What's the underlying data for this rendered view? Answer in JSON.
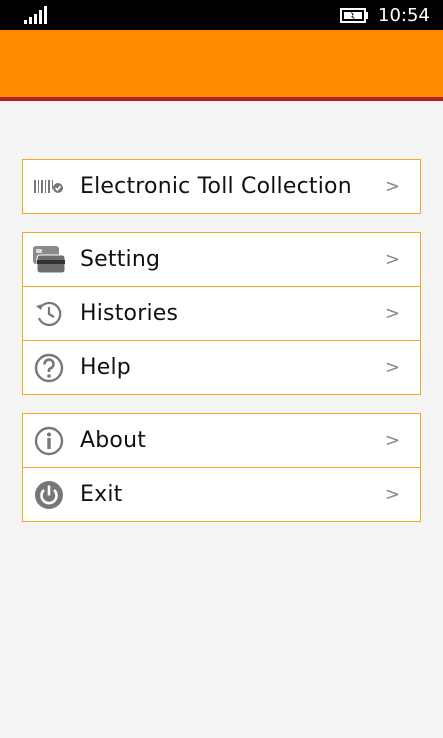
{
  "status_bar": {
    "time": "10:54"
  },
  "groups": [
    {
      "items": [
        {
          "label": "Electronic Toll Collection",
          "icon": "barcode-icon",
          "chevron": ">"
        }
      ]
    },
    {
      "items": [
        {
          "label": "Setting",
          "icon": "cards-icon",
          "chevron": ">"
        },
        {
          "label": "Histories",
          "icon": "history-icon",
          "chevron": ">"
        },
        {
          "label": "Help",
          "icon": "help-icon",
          "chevron": ">"
        }
      ]
    },
    {
      "items": [
        {
          "label": "About",
          "icon": "info-icon",
          "chevron": ">"
        },
        {
          "label": "Exit",
          "icon": "power-icon",
          "chevron": ">"
        }
      ]
    }
  ],
  "colors": {
    "header": "#ff8c00",
    "header_rule": "#b22222",
    "item_border": "#f5a623"
  }
}
